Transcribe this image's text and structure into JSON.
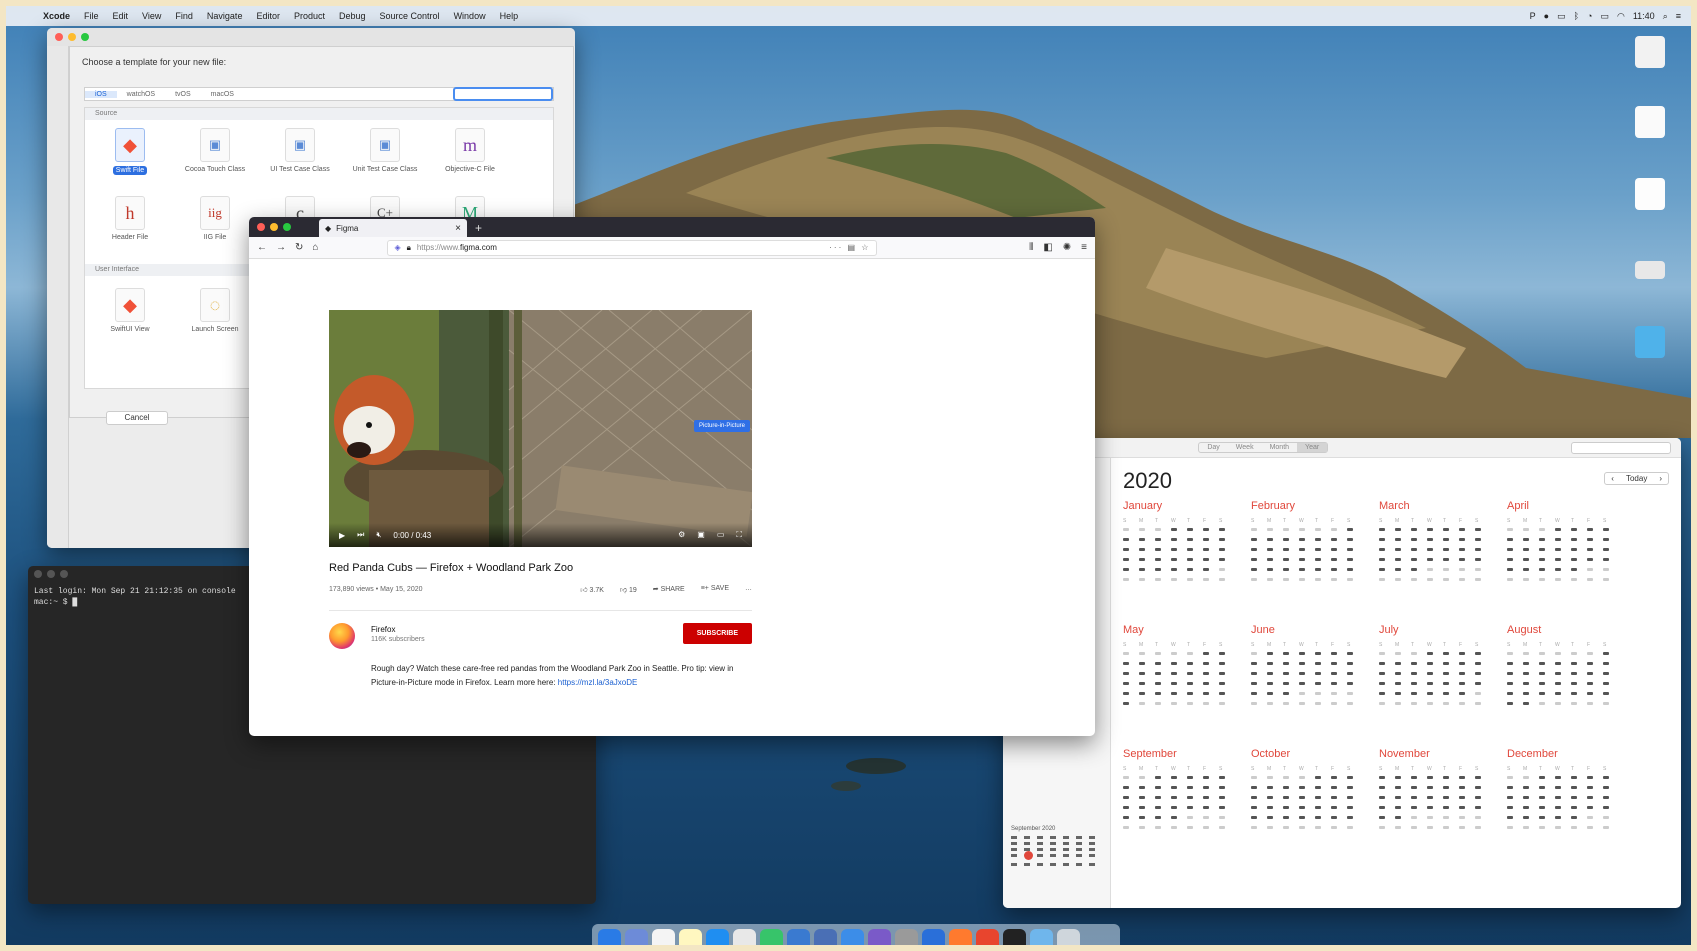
{
  "menubar": {
    "app": "Xcode",
    "items": [
      "File",
      "Edit",
      "View",
      "Find",
      "Navigate",
      "Editor",
      "Product",
      "Debug",
      "Source Control",
      "Window",
      "Help"
    ],
    "clock": "11:40"
  },
  "xcode": {
    "sheet_title": "Choose a template for your new file:",
    "segments": [
      "iOS",
      "watchOS",
      "tvOS",
      "macOS"
    ],
    "section_source": "Source",
    "section_ui": "User Interface",
    "tiles": [
      {
        "label": "Swift File",
        "glyph": "◆"
      },
      {
        "label": "Cocoa Touch Class",
        "glyph": "▣"
      },
      {
        "label": "UI Test Case Class",
        "glyph": "▣"
      },
      {
        "label": "Unit Test Case Class",
        "glyph": "▣"
      },
      {
        "label": "Objective-C File",
        "glyph": "m"
      },
      {
        "label": "Header File",
        "glyph": "h"
      },
      {
        "label": "IIG File",
        "glyph": "iig"
      },
      {
        "label": "",
        "glyph": "c"
      },
      {
        "label": "",
        "glyph": "C+"
      },
      {
        "label": "",
        "glyph": "M"
      }
    ],
    "ui_tiles": [
      {
        "label": "SwiftUI View",
        "glyph": "◆"
      },
      {
        "label": "Launch Screen",
        "glyph": "◌"
      }
    ],
    "cancel": "Cancel"
  },
  "terminal": {
    "lines": [
      "Last login: Mon Sep 21 21:12:35 on console",
      "mac:~ $ █"
    ]
  },
  "firefox": {
    "tab_title": "Figma",
    "url_prefix": "https://www.",
    "url_domain": "figma.com",
    "video": {
      "pip_label": "Picture-in-Picture",
      "time": "0:00 / 0:43",
      "title": "Red Panda Cubs — Firefox + Woodland Park Zoo",
      "meta": "173,890 views • May 15, 2020",
      "likes": "3.7K",
      "dislikes": "19",
      "share": "Share",
      "save": "Save",
      "more": "…",
      "channel": "Firefox",
      "subscribers": "116K subscribers",
      "subscribe": "SUBSCRIBE",
      "description": "Rough day? Watch these care-free red pandas from the Woodland Park Zoo in Seattle. Pro tip: view in Picture-in-Picture mode in Firefox. Learn more here:",
      "link": "https://mzl.la/3aJxoDE"
    }
  },
  "calendar": {
    "year": "2020",
    "today": "Today",
    "views": [
      "Day",
      "Week",
      "Month",
      "Year"
    ],
    "months": [
      "January",
      "February",
      "March",
      "April",
      "May",
      "June",
      "July",
      "August",
      "September",
      "October",
      "November",
      "December"
    ],
    "mini_title": "September 2020",
    "weekday_initials": [
      "S",
      "M",
      "T",
      "W",
      "T",
      "F",
      "S"
    ]
  },
  "colors": {
    "accent": "#2d6fe0",
    "calendar_red": "#e0473b",
    "subscribe_red": "#cc0000"
  }
}
